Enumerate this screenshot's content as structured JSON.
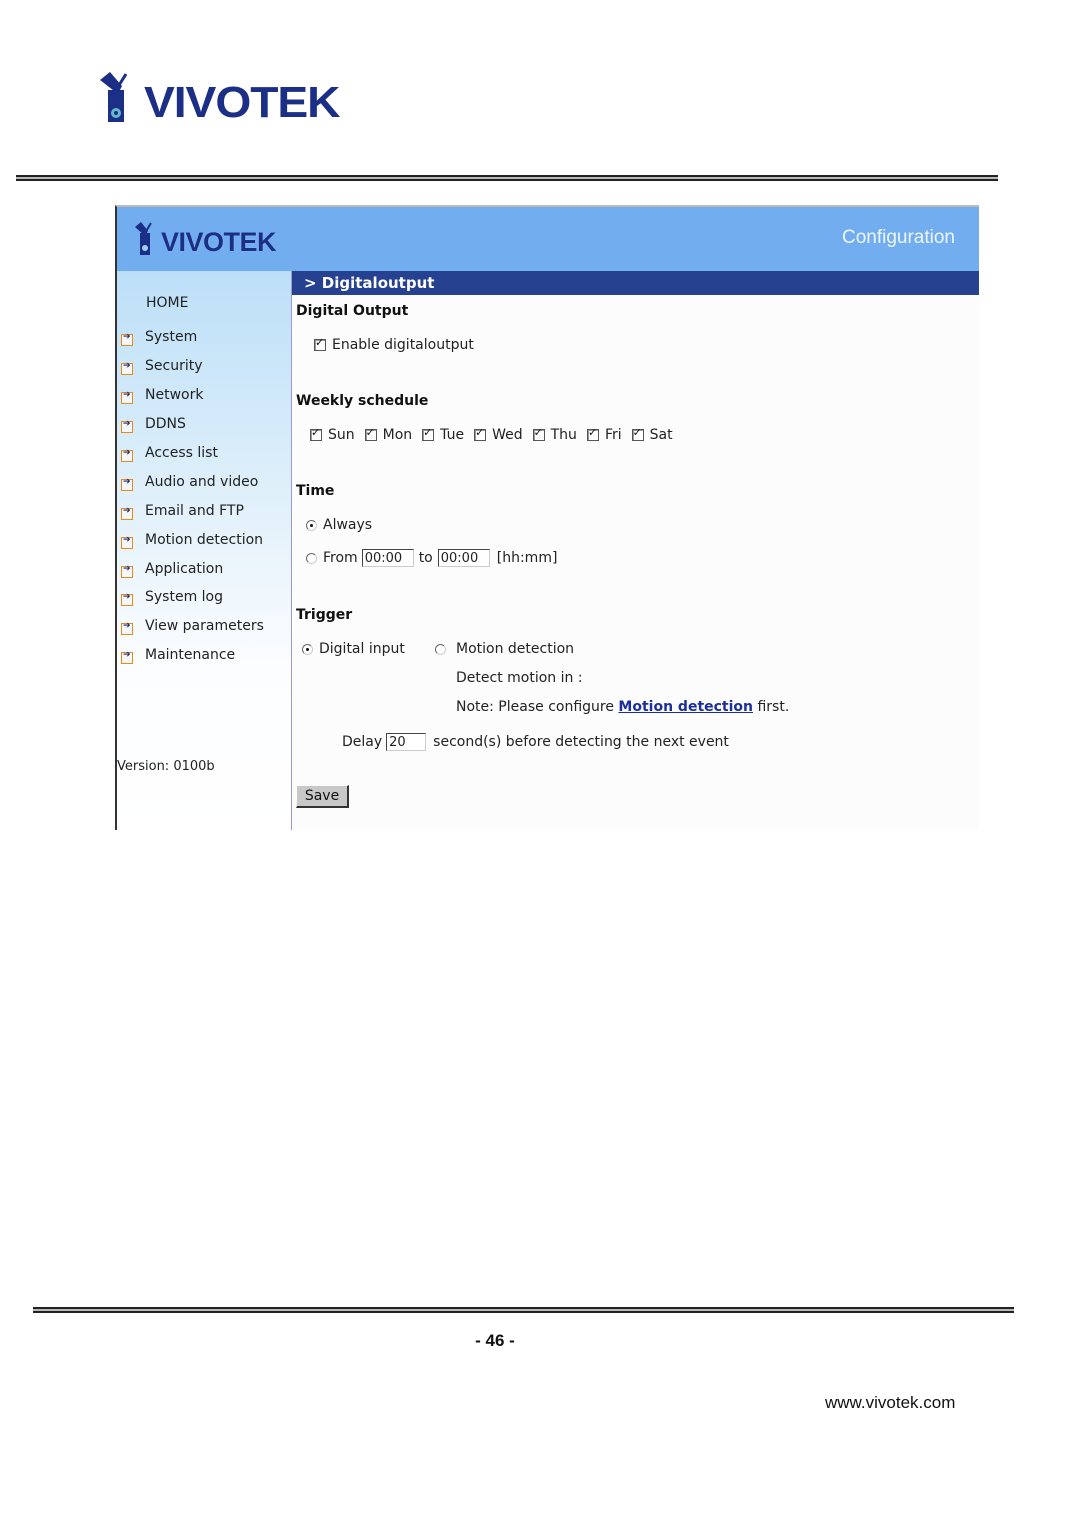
{
  "document": {
    "brand": "VIVOTEK",
    "page_number": "- 46 -",
    "website": "www.vivotek.com"
  },
  "app": {
    "brand": "VIVOTEK",
    "header_title": "Configuration",
    "colors": {
      "header_bg": "#71adef",
      "section_bar_bg": "#26418f",
      "link": "#1c2f9e",
      "nav_arrow_border": "#e58a1e"
    },
    "sidebar": {
      "home": "HOME",
      "items": [
        {
          "label": "System"
        },
        {
          "label": "Security"
        },
        {
          "label": "Network"
        },
        {
          "label": "DDNS"
        },
        {
          "label": "Access list"
        },
        {
          "label": "Audio and video"
        },
        {
          "label": "Email and FTP"
        },
        {
          "label": "Motion detection"
        },
        {
          "label": "Application"
        },
        {
          "label": "System log"
        },
        {
          "label": "View parameters"
        },
        {
          "label": "Maintenance"
        }
      ],
      "version": "Version: 0100b"
    },
    "section_title": "> Digitaloutput",
    "digital_output": {
      "heading": "Digital Output",
      "enable_label": "Enable digitaloutput",
      "enable_checked": true
    },
    "weekly_schedule": {
      "heading": "Weekly schedule",
      "days": [
        {
          "label": "Sun",
          "checked": true
        },
        {
          "label": "Mon",
          "checked": true
        },
        {
          "label": "Tue",
          "checked": true
        },
        {
          "label": "Wed",
          "checked": true
        },
        {
          "label": "Thu",
          "checked": true
        },
        {
          "label": "Fri",
          "checked": true
        },
        {
          "label": "Sat",
          "checked": true
        }
      ]
    },
    "time": {
      "heading": "Time",
      "always_label": "Always",
      "always_selected": true,
      "from_label": "From",
      "from_value": "00:00",
      "to_label": "to",
      "to_value": "00:00",
      "format_hint": "[hh:mm]"
    },
    "trigger": {
      "heading": "Trigger",
      "digital_input_label": "Digital input",
      "digital_input_selected": true,
      "motion_label": "Motion detection",
      "motion_selected": false,
      "detect_motion_in": "Detect motion in :",
      "note_prefix": "Note: Please configure ",
      "note_link": "Motion detection",
      "note_suffix": " first.",
      "delay_label": "Delay",
      "delay_value": "20",
      "delay_suffix": "second(s) before detecting the next event"
    },
    "save_label": "Save"
  }
}
